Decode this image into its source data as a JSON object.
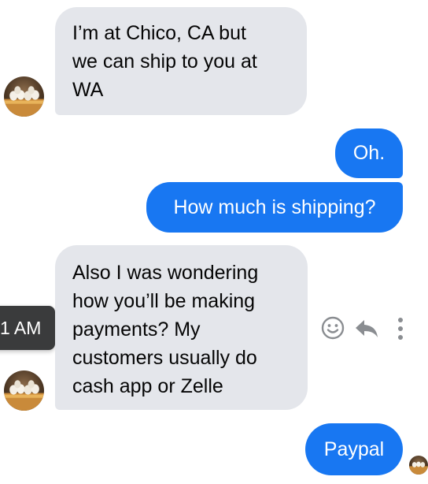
{
  "messages": [
    {
      "id": "m1",
      "direction": "incoming",
      "lines": [
        "I’m at Chico, CA but",
        "we can ship to you at",
        "WA"
      ]
    },
    {
      "id": "m2",
      "direction": "outgoing",
      "text": "Oh."
    },
    {
      "id": "m3",
      "direction": "outgoing",
      "text": "How much is shipping?"
    },
    {
      "id": "m4",
      "direction": "incoming",
      "lines": [
        "Also I was wondering",
        "how you’ll be making",
        "payments? My",
        "customers usually do",
        "cash app or Zelle"
      ]
    },
    {
      "id": "m5",
      "direction": "outgoing",
      "text": "Paypal"
    }
  ],
  "timestamp_tooltip": "1 AM",
  "message_actions": [
    "smiley-reaction-icon",
    "reply-icon",
    "more-options-icon"
  ],
  "colors": {
    "incoming_bubble": "#e4e6eb",
    "outgoing_bubble": "#1877f2",
    "tooltip_bg": "#3a3b3c",
    "action_icons": "#8a8d91"
  }
}
